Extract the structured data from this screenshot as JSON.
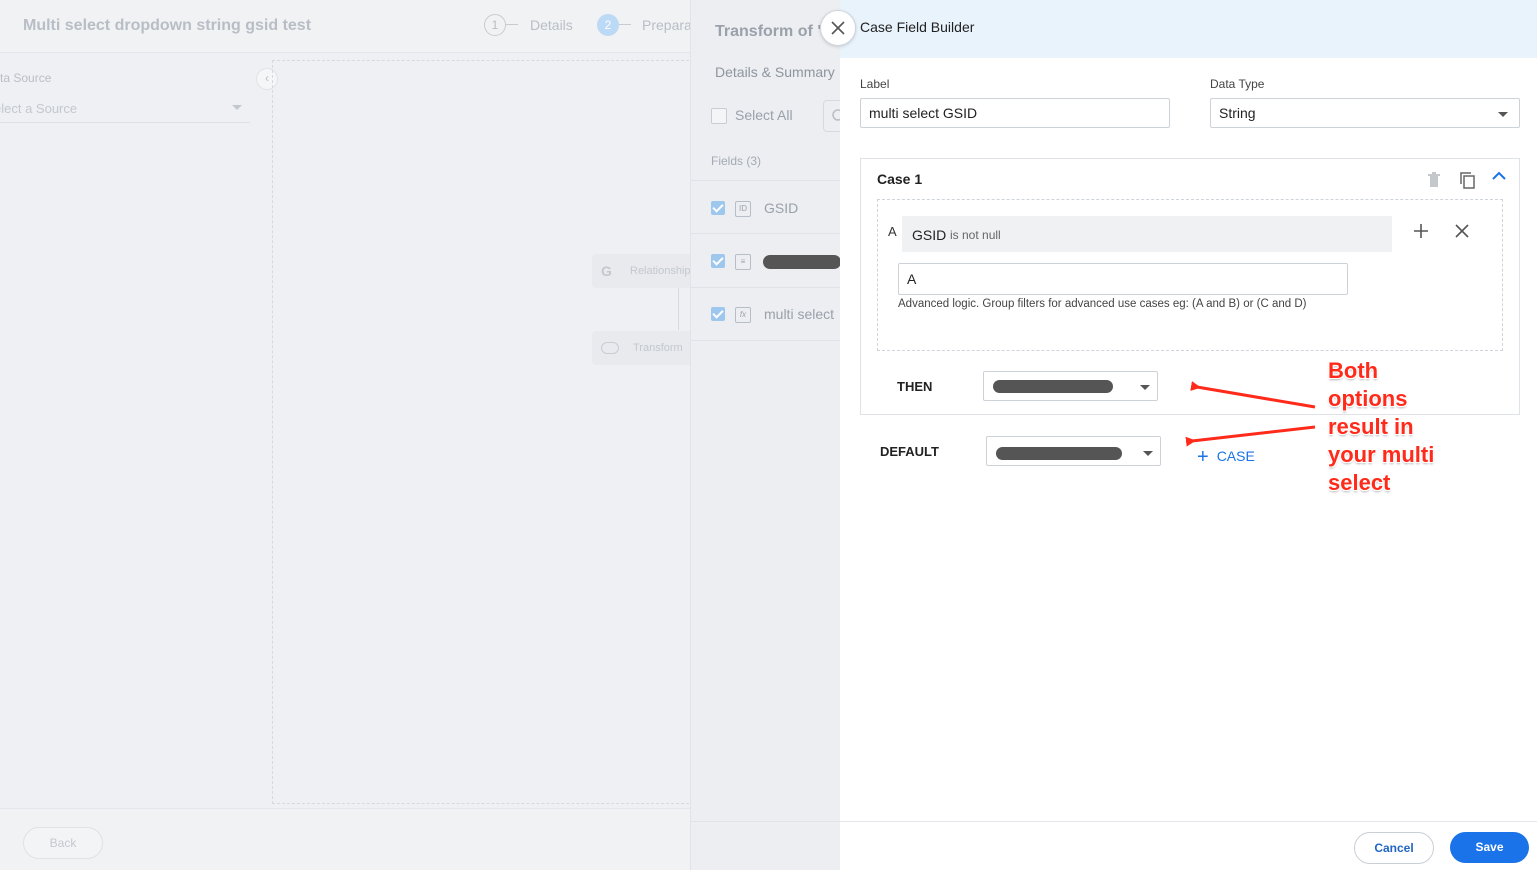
{
  "background_app": {
    "title": "Multi select dropdown string gsid test",
    "steps": [
      {
        "number": "1",
        "label": "Details"
      },
      {
        "number": "2",
        "label": "Prepara"
      }
    ],
    "source_label": "ta Source",
    "source_placeholder": "elect a Source",
    "nodes": [
      {
        "icon": "G",
        "label": "Relationship"
      },
      {
        "label": "Transform"
      }
    ],
    "back_label": "Back"
  },
  "transform_panel": {
    "title": "Transform of \"I",
    "tab": "Details & Summary",
    "select_all_label": "Select All",
    "fields_header": "Fields (3)",
    "fields": [
      {
        "icon": "ID",
        "name": "GSID",
        "checked": true
      },
      {
        "icon": "≡",
        "name": "",
        "checked": true,
        "redacted": true
      },
      {
        "icon": "fx",
        "name": "multi select",
        "checked": true
      }
    ]
  },
  "drawer": {
    "title": "Case Field Builder",
    "label_caption": "Label",
    "label_value": "multi select GSID",
    "datatype_caption": "Data Type",
    "datatype_value": "String",
    "case": {
      "title": "Case 1",
      "condition": {
        "letter": "A",
        "field": "GSID",
        "operator": "is not null"
      },
      "logic_value": "A",
      "logic_hint": "Advanced logic. Group filters for advanced use cases eg: (A and B) or (C and D)",
      "then_label": "THEN"
    },
    "default_label": "DEFAULT",
    "add_case_label": "CASE",
    "cancel_label": "Cancel",
    "save_label": "Save"
  },
  "annotation": {
    "lines": [
      "Both",
      "options",
      "result in",
      "your multi",
      "select"
    ],
    "color": "#ff2a1a"
  },
  "colors": {
    "accent": "#1a73e8",
    "header_bg": "#e9f3fc",
    "annotation": "#ff2a1a"
  }
}
